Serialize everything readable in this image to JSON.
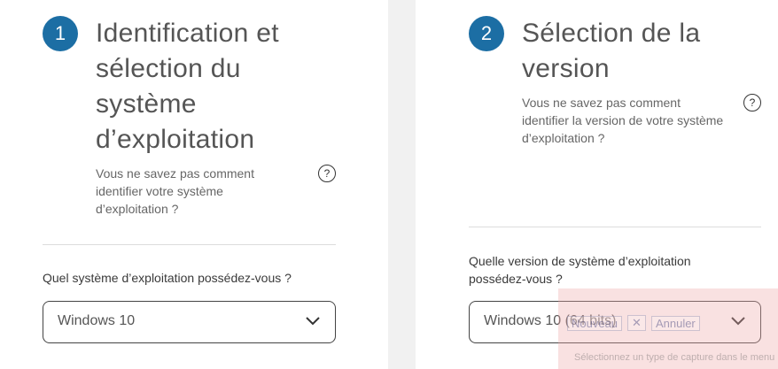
{
  "step1": {
    "number": "1",
    "title_lines": [
      "Identification et",
      "sélection du",
      "système",
      "d’exploitation"
    ],
    "help_lines": [
      "Vous ne savez pas comment",
      "identifier votre système",
      "d’exploitation ?"
    ],
    "help_icon": "?",
    "question": "Quel système d’exploitation possédez-vous ?",
    "select_value": "Windows 10"
  },
  "step2": {
    "number": "2",
    "title_lines": [
      "Sélection de la",
      "version"
    ],
    "help_lines": [
      "Vous ne savez pas comment",
      "identifier la version de votre système",
      "d’exploitation ?"
    ],
    "help_icon": "?",
    "question_lines": [
      "Quelle version de système d’exploitation",
      "possédez-vous ?"
    ],
    "select_value": "Windows 10 (64 bits)"
  },
  "snip_overlay": {
    "new_label": "Nouveau",
    "cancel_label": "Annuler",
    "hint": "Sélectionnez un type de capture dans le menu"
  },
  "colors": {
    "accent": "#1c6ea4",
    "page_bg": "#f1f1f1",
    "panel_bg": "#ffffff"
  },
  "icons": [
    "help-circle-icon",
    "chevron-down-icon",
    "close-icon"
  ]
}
